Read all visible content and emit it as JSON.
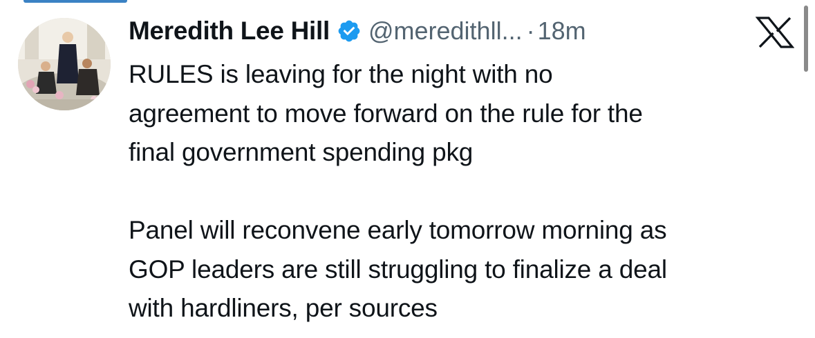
{
  "author": {
    "name": "Meredith Lee Hill",
    "handle": "@meredithll...",
    "separator": "·",
    "time": "18m",
    "verified_badge_color": "#1d9bf0"
  },
  "tweet": {
    "lines": [
      "RULES is leaving for the night with no",
      "agreement to move forward on the rule for the",
      "final government spending pkg",
      "",
      "Panel will reconvene early tomorrow morning as",
      "GOP leaders are still struggling to finalize a deal",
      "with hardliners, per sources"
    ]
  },
  "icons": {
    "avatar": "avatar-photo",
    "verified": "verified-badge-icon",
    "platform": "x-logo-icon"
  },
  "colors": {
    "text": "#0f1419",
    "secondary": "#536471",
    "accent": "#1d9bf0"
  }
}
